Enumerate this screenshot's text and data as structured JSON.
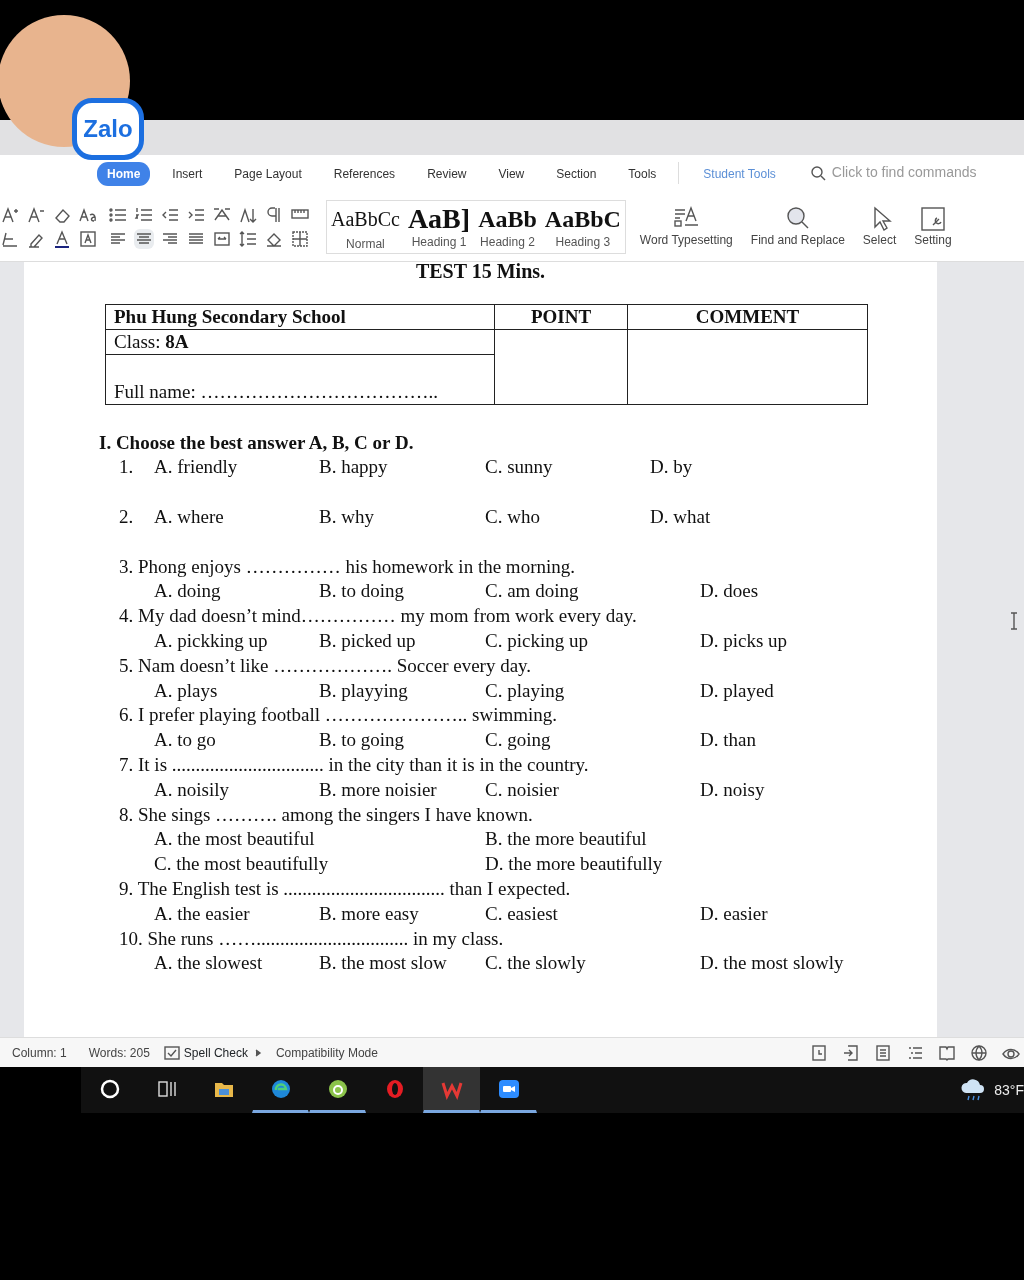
{
  "overlay": {
    "badge": "Zalo"
  },
  "tabs": [
    {
      "label": "Home",
      "selected": true
    },
    {
      "label": "Insert",
      "selected": false
    },
    {
      "label": "Page Layout",
      "selected": false
    },
    {
      "label": "References",
      "selected": false
    },
    {
      "label": "Review",
      "selected": false
    },
    {
      "label": "View",
      "selected": false
    },
    {
      "label": "Section",
      "selected": false
    },
    {
      "label": "Tools",
      "selected": false
    },
    {
      "label": "Student Tools",
      "selected": false,
      "kind": "accent"
    }
  ],
  "search": {
    "placeholder": "Click to find commands"
  },
  "styles": [
    {
      "sample": "AaBbCc",
      "name": "Normal",
      "kind": "normal"
    },
    {
      "sample": "AaB]",
      "name": "Heading 1",
      "kind": "h1"
    },
    {
      "sample": "AaBb",
      "name": "Heading 2",
      "kind": "h2"
    },
    {
      "sample": "AaBbC",
      "name": "Heading 3",
      "kind": "h3"
    }
  ],
  "ribbon_buttons": [
    {
      "label": "Word Typesetting",
      "kind": "typeset"
    },
    {
      "label": "Find and Replace",
      "kind": "find"
    },
    {
      "label": "Select",
      "kind": "select"
    },
    {
      "label": "Setting",
      "kind": "setting"
    }
  ],
  "document": {
    "title": "TEST 15 Mins.",
    "header_table": {
      "school": "Phu Hung Secondary School",
      "point": "POINT",
      "comment": "COMMENT",
      "class_line": "Class: **8A**",
      "name_line": "Full name: ……………………………….."
    },
    "section": "I. Choose the best answer A, B, C or D.",
    "questions": [
      {
        "number": "1.",
        "kind": "four",
        "options": [
          "A. friendly",
          "B. happy",
          "C. sunny",
          "D. by"
        ]
      },
      {
        "number": "2.",
        "kind": "four",
        "options": [
          "A. where",
          "B. why",
          "C. who",
          "D. what"
        ]
      },
      {
        "number": "3.",
        "stem": "Phong enjoys …………… his homework in the morning.",
        "kind": "four",
        "options": [
          "A. doing",
          "B. to doing",
          "C. am doing",
          "D.  does"
        ]
      },
      {
        "number": "4.",
        "stem": "My dad doesn’t mind…………… my mom from work every day.",
        "kind": "four",
        "options": [
          "A. pickking up",
          "B. picked up",
          "C. picking up",
          "D. picks up"
        ]
      },
      {
        "number": "5.",
        "stem": "Nam doesn’t like ………………. Soccer every day.",
        "kind": "four",
        "options": [
          "A. plays",
          "B. playying",
          "C. playing",
          "D. played"
        ]
      },
      {
        "number": "6.",
        "stem": "I prefer playing football ………………….. swimming.",
        "kind": "four",
        "options": [
          "A. to go",
          "B.  to going",
          "C.  going",
          "D.  than"
        ]
      },
      {
        "number": "7.",
        "stem": "It is ................................ in the city than it is in the country.",
        "kind": "four",
        "options": [
          "A. noisily",
          "B. more noisier",
          "C. noisier",
          "D. noisy"
        ]
      },
      {
        "number": "8.",
        "stem": "She sings ………. among the singers I have known.",
        "kind": "two",
        "options": [
          "A. the most beautiful",
          "B. the more beautiful",
          "C. the most beautifully",
          "D. the more beautifully"
        ]
      },
      {
        "number": "9.",
        "stem": "The English test is .................................. than I expected.",
        "kind": "four",
        "options": [
          "A. the easier",
          "B. more easy",
          "C. easiest",
          "D. easier"
        ]
      },
      {
        "number": "10.",
        "stem": "She runs ……................................ in my class.",
        "kind": "four",
        "options": [
          "A. the slowest",
          "B. the most slow",
          "C. the slowly",
          "D. the most slowly"
        ]
      }
    ]
  },
  "status_bar": {
    "items": [
      "Column: 1",
      "Words: 205",
      "Spell Check",
      "Compatibility Mode"
    ]
  },
  "taskbar": {
    "temperature": "83°F"
  }
}
